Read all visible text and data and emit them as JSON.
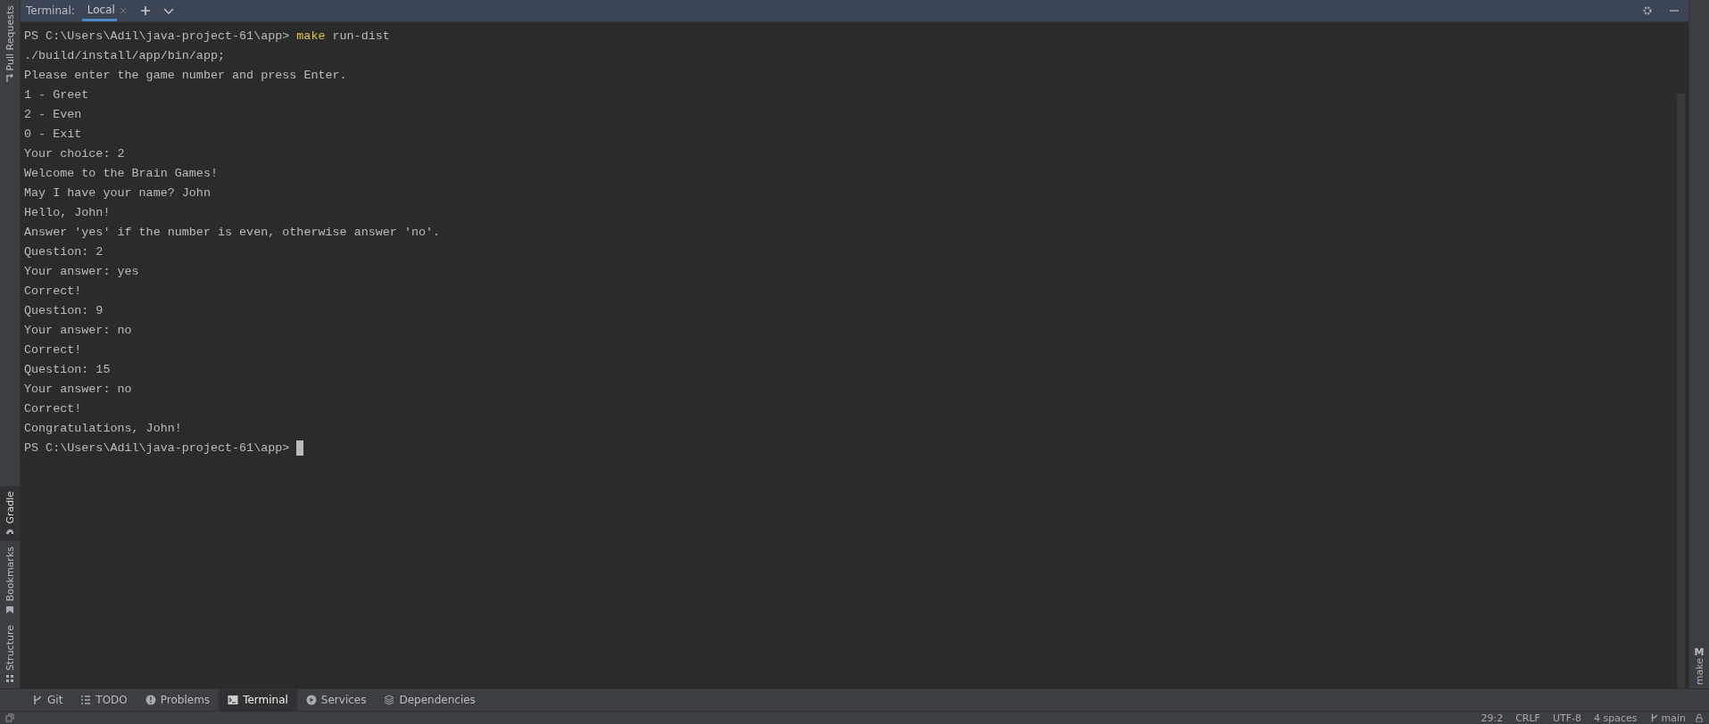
{
  "header": {
    "title": "Terminal:",
    "tabs": [
      {
        "label": "Local",
        "selected": true
      }
    ]
  },
  "terminal": {
    "lines": [
      {
        "kind": "prompt",
        "path": "PS C:\\Users\\Adil\\java-project-61\\app>",
        "command": "make",
        "args": "run-dist"
      },
      {
        "kind": "output",
        "text": "./build/install/app/bin/app;"
      },
      {
        "kind": "output",
        "text": "Please enter the game number and press Enter."
      },
      {
        "kind": "output",
        "text": "1 - Greet"
      },
      {
        "kind": "output",
        "text": "2 - Even"
      },
      {
        "kind": "output",
        "text": "0 - Exit"
      },
      {
        "kind": "output",
        "text": "Your choice: 2"
      },
      {
        "kind": "output",
        "text": "Welcome to the Brain Games!"
      },
      {
        "kind": "output",
        "text": "May I have your name? John"
      },
      {
        "kind": "output",
        "text": "Hello, John!"
      },
      {
        "kind": "output",
        "text": "Answer 'yes' if the number is even, otherwise answer 'no'."
      },
      {
        "kind": "output",
        "text": "Question: 2"
      },
      {
        "kind": "output",
        "text": "Your answer: yes"
      },
      {
        "kind": "output",
        "text": "Correct!"
      },
      {
        "kind": "output",
        "text": "Question: 9"
      },
      {
        "kind": "output",
        "text": "Your answer: no"
      },
      {
        "kind": "output",
        "text": "Correct!"
      },
      {
        "kind": "output",
        "text": "Question: 15"
      },
      {
        "kind": "output",
        "text": "Your answer: no"
      },
      {
        "kind": "output",
        "text": "Correct!"
      },
      {
        "kind": "output",
        "text": "Congratulations, John!"
      },
      {
        "kind": "prompt",
        "path": "PS C:\\Users\\Adil\\java-project-61\\app>",
        "cursor": true
      }
    ]
  },
  "left_sidebar": {
    "top": [
      {
        "label": "Pull Requests",
        "kind": "pull-request",
        "selected": false
      }
    ],
    "bottom": [
      {
        "label": "Gradle",
        "kind": "gradle",
        "selected": true
      },
      {
        "label": "Bookmarks",
        "kind": "bookmarks",
        "selected": false
      },
      {
        "label": "Structure",
        "kind": "structure",
        "selected": false
      }
    ]
  },
  "right_sidebar": {
    "items": [
      {
        "glyph": "M",
        "label": "make"
      }
    ]
  },
  "tool_windows": [
    {
      "label": "Git",
      "kind": "git",
      "selected": false
    },
    {
      "label": "TODO",
      "kind": "todo",
      "selected": false
    },
    {
      "label": "Problems",
      "kind": "problems",
      "selected": false
    },
    {
      "label": "Terminal",
      "kind": "terminal",
      "selected": true
    },
    {
      "label": "Services",
      "kind": "services",
      "selected": false
    },
    {
      "label": "Dependencies",
      "kind": "dependencies",
      "selected": false
    }
  ],
  "status_bar": {
    "items": [
      "29:2",
      "CRLF",
      "UTF-8",
      "4 spaces"
    ],
    "branch": "main"
  }
}
